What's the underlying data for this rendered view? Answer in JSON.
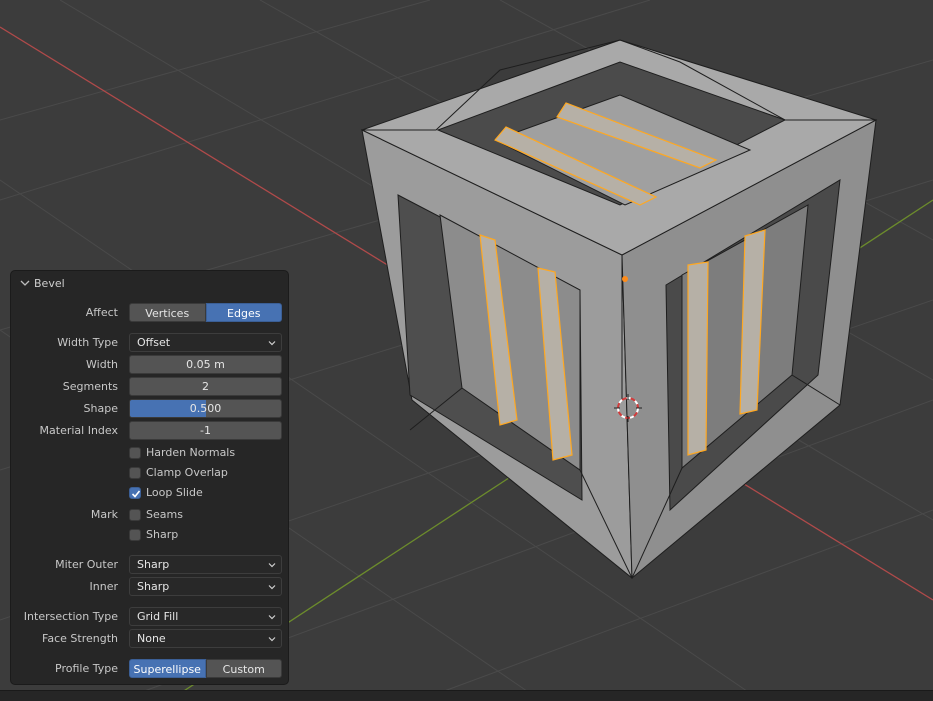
{
  "viewport": {
    "colors": {
      "background": "#3c3c3c",
      "grid": "#4a4a4a",
      "x_axis": "#b04a4a",
      "y_axis": "#6c8c2c",
      "face_light": "#a9a9a9",
      "face_mid": "#8f8f8f",
      "face_dark": "#4a4a4a",
      "selection": "#ffa821"
    },
    "cursor_icon": "3d-cursor-icon"
  },
  "panel": {
    "title": "Bevel",
    "affect_label": "Affect",
    "affect_options": [
      "Vertices",
      "Edges"
    ],
    "affect_selected": "Edges",
    "width_type_label": "Width Type",
    "width_type_value": "Offset",
    "width_label": "Width",
    "width_value": "0.05 m",
    "segments_label": "Segments",
    "segments_value": "2",
    "shape_label": "Shape",
    "shape_value": "0.500",
    "shape_fraction": 0.5,
    "material_index_label": "Material Index",
    "material_index_value": "-1",
    "harden_normals_label": "Harden Normals",
    "harden_normals_checked": false,
    "clamp_overlap_label": "Clamp Overlap",
    "clamp_overlap_checked": false,
    "loop_slide_label": "Loop Slide",
    "loop_slide_checked": true,
    "mark_label": "Mark",
    "seams_label": "Seams",
    "seams_checked": false,
    "sharp_label": "Sharp",
    "sharp_checked": false,
    "miter_outer_label": "Miter Outer",
    "miter_outer_value": "Sharp",
    "inner_label": "Inner",
    "inner_value": "Sharp",
    "intersection_type_label": "Intersection Type",
    "intersection_type_value": "Grid Fill",
    "face_strength_label": "Face Strength",
    "face_strength_value": "None",
    "profile_type_label": "Profile Type",
    "profile_type_options": [
      "Superellipse",
      "Custom"
    ],
    "profile_type_selected": "Superellipse"
  }
}
